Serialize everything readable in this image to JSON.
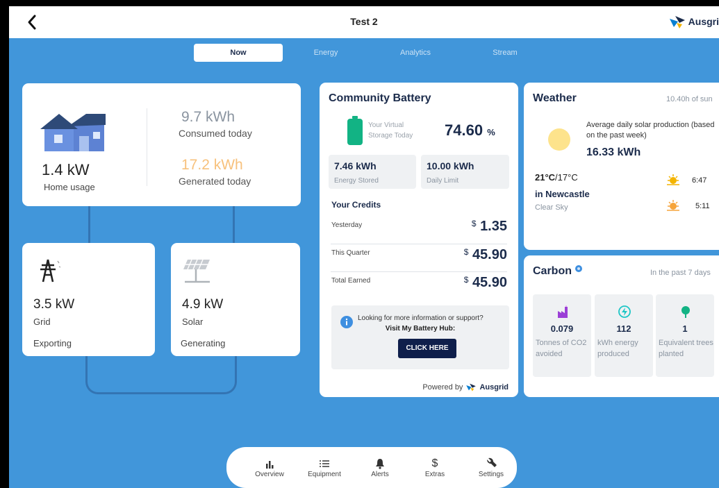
{
  "header": {
    "title": "Test 2",
    "brand": "Ausgri"
  },
  "tabs": [
    {
      "label": "Now",
      "active": true
    },
    {
      "label": "Energy",
      "active": false
    },
    {
      "label": "Analytics",
      "active": false
    },
    {
      "label": "Stream",
      "active": false
    }
  ],
  "home": {
    "power": "1.4 kW",
    "power_label": "Home usage",
    "consumed": "9.7 kWh",
    "consumed_label": "Consumed today",
    "generated": "17.2 kWh",
    "generated_label": "Generated today"
  },
  "grid": {
    "power": "3.5 kW",
    "label": "Grid",
    "status": "Exporting"
  },
  "solar": {
    "power": "4.9 kW",
    "label": "Solar",
    "status": "Generating"
  },
  "battery": {
    "title": "Community Battery",
    "storage_label": "Your Virtual Storage Today",
    "storage_value": "74.60",
    "storage_unit": "%",
    "stored_value": "7.46 kWh",
    "stored_label": "Energy Stored",
    "limit_value": "10.00 kWh",
    "limit_label": "Daily Limit",
    "credits_title": "Your Credits",
    "credits": [
      {
        "label": "Yesterday",
        "currency": "$",
        "value": "1.35"
      },
      {
        "label": "This Quarter",
        "currency": "$",
        "value": "45.90"
      },
      {
        "label": "Total Earned",
        "currency": "$",
        "value": "45.90"
      }
    ],
    "info_text": "Looking for more information or support?",
    "info_bold": "Visit My Battery Hub:",
    "cta": "CLICK HERE",
    "powered_by": "Powered by",
    "powered_brand": "Ausgrid"
  },
  "weather": {
    "title": "Weather",
    "sun_hours": "10.40h of sun",
    "avg_text": "Average daily solar production (based on the past week)",
    "avg_value": "16.33 kWh",
    "temp_high": "21°C",
    "temp_low": "/17°C",
    "location": "in Newcastle",
    "condition": "Clear Sky",
    "sunrise": "6:47",
    "sunset": "5:11"
  },
  "carbon": {
    "title": "Carbon",
    "period": "In the past 7 days",
    "stats": [
      {
        "value": "0.079",
        "label": "Tonnes of CO2 avoided",
        "icon": "factory-icon",
        "color": "#9b3fd6"
      },
      {
        "value": "112",
        "label": "kWh energy produced",
        "icon": "bolt-icon",
        "color": "#1ec6c6"
      },
      {
        "value": "1",
        "label": "Equivalent trees planted",
        "icon": "tree-icon",
        "color": "#12b384"
      }
    ]
  },
  "nav": [
    {
      "label": "Overview",
      "icon": "bar-chart-icon"
    },
    {
      "label": "Equipment",
      "icon": "list-icon"
    },
    {
      "label": "Alerts",
      "icon": "bell-icon"
    },
    {
      "label": "Extras",
      "icon": "dollar-icon"
    },
    {
      "label": "Settings",
      "icon": "wrench-icon"
    }
  ],
  "colors": {
    "background": "#4196da",
    "accent_orange": "#f7c17c",
    "battery_green": "#12b384",
    "navy": "#0f1f4b"
  }
}
